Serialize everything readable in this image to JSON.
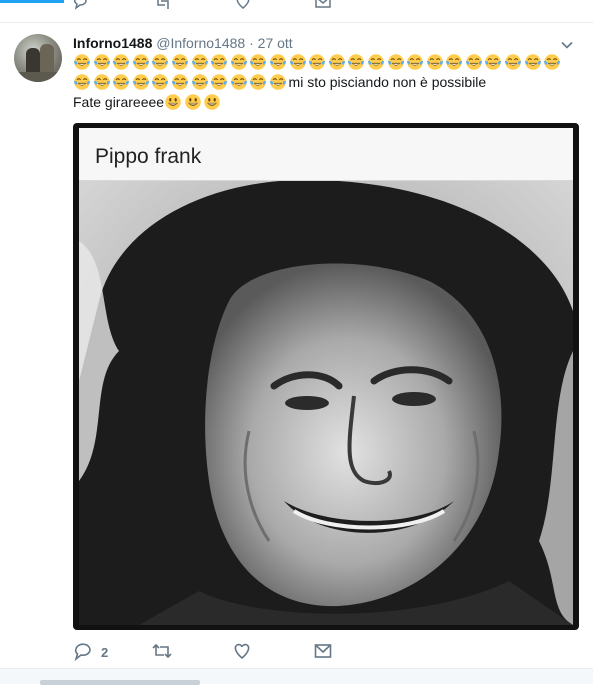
{
  "colors": {
    "accent": "#1da1f2",
    "muted": "#657786",
    "emoji_face": "#ffcc4d",
    "emoji_tear": "#5dadec"
  },
  "top_actions": [
    "reply-icon",
    "retweet-icon",
    "like-icon",
    "message-icon"
  ],
  "tweet": {
    "display_name": "Inforno1488",
    "handle": "@Inforno1488",
    "separator": "·",
    "time": "27 ott",
    "emoji_row1_count": 25,
    "emoji_row2_count": 11,
    "text_after_emojis": "mi sto pisciando non è possibile",
    "line3_text": "Fate girareeee",
    "line3_emoji_count": 3,
    "media": {
      "caption": "Pippo frank"
    },
    "actions": {
      "reply_count": "2",
      "icons": [
        "reply-icon",
        "retweet-icon",
        "like-icon",
        "message-icon"
      ]
    }
  }
}
